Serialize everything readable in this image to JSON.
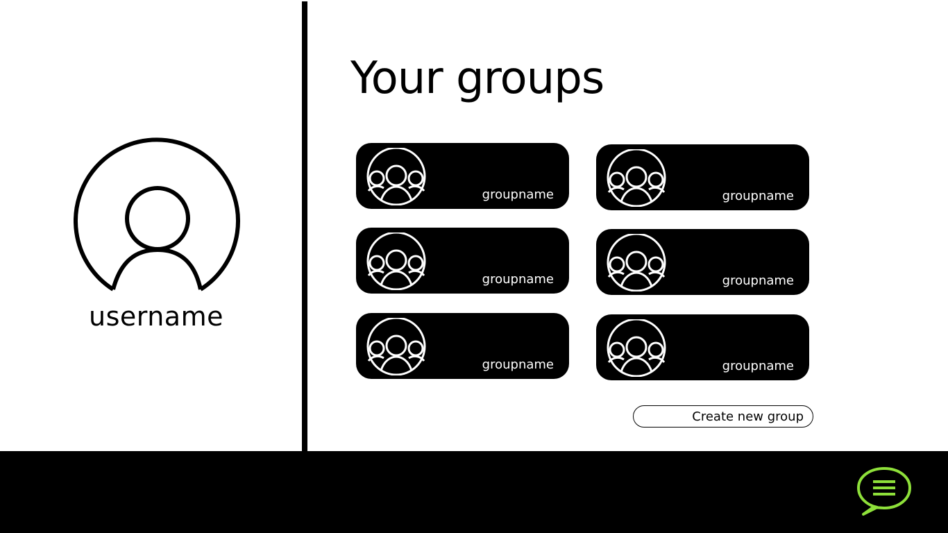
{
  "profile": {
    "avatar_icon": "user-avatar-icon",
    "username": "username"
  },
  "main": {
    "title": "Your groups",
    "groups": [
      {
        "name": "groupname",
        "icon": "group-icon"
      },
      {
        "name": "groupname",
        "icon": "group-icon"
      },
      {
        "name": "groupname",
        "icon": "group-icon"
      },
      {
        "name": "groupname",
        "icon": "group-icon"
      },
      {
        "name": "groupname",
        "icon": "group-icon"
      },
      {
        "name": "groupname",
        "icon": "group-icon"
      }
    ],
    "create_button_label": "Create new group"
  },
  "footer": {
    "chat_icon": "chat-menu-icon",
    "chat_icon_color": "#8ee03a"
  },
  "colors": {
    "background": "#ffffff",
    "primary": "#000000",
    "card_text": "#ffffff",
    "accent": "#8ee03a"
  }
}
